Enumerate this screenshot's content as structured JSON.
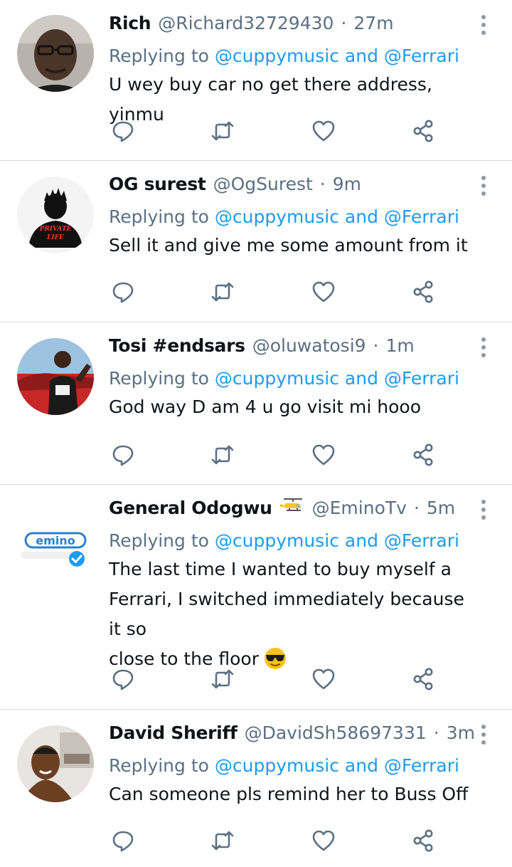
{
  "labels": {
    "replying_to": "Replying to",
    "and": "and"
  },
  "tweets": [
    {
      "name": "Rich",
      "handle": "@Richard32729430",
      "separator": "·",
      "time": "27m",
      "mentions": [
        "@cuppymusic",
        "@Ferrari"
      ],
      "text": "U wey buy car no get there address, yinmu",
      "avatar": "bald-man-glasses-avatar"
    },
    {
      "name": "OG surest",
      "handle": "@OgSurest",
      "separator": "·",
      "time": "9m",
      "mentions": [
        "@cuppymusic",
        "@Ferrari"
      ],
      "text": "Sell it and give me some amount from it",
      "avatar": "silhouette-avatar",
      "avatar_text": [
        "PRIVATE",
        "LIFE"
      ]
    },
    {
      "name": "Tosi #endsars",
      "handle": "@oluwatosi9",
      "separator": "·",
      "time": "1m",
      "mentions": [
        "@cuppymusic",
        "@Ferrari"
      ],
      "text": "God way D am 4 u go visit mi hooo",
      "avatar": "man-red-car-avatar"
    },
    {
      "name": "General Odogwu",
      "name_emoji": "helicopter-emoji",
      "handle": "@EminoTv",
      "separator": "·",
      "time": "5m",
      "mentions": [
        "@cuppymusic",
        "@Ferrari"
      ],
      "text_lines": [
        "The last time I wanted to buy myself a",
        "Ferrari, I switched immediately because it so",
        "close to the floor"
      ],
      "text_emoji": "sunglasses-face-emoji",
      "avatar": "emino-logo-avatar",
      "avatar_text": "emino"
    },
    {
      "name": "David Sheriff",
      "handle": "@DavidSh58697331",
      "separator": "·",
      "time": "3m",
      "mentions": [
        "@cuppymusic",
        "@Ferrari"
      ],
      "text": "Can someone pls remind her to Buss Off",
      "avatar": "smiling-man-avatar"
    }
  ],
  "icons": {
    "reply": "reply-icon",
    "retweet": "retweet-icon",
    "like": "heart-icon",
    "share": "share-icon",
    "more": "more-icon"
  },
  "colors": {
    "link": "#1d9bf0",
    "secondary_text": "#5b7083",
    "icon": "#5b7083",
    "divider": "#d8dde1",
    "verified": "#1d9bf0"
  }
}
